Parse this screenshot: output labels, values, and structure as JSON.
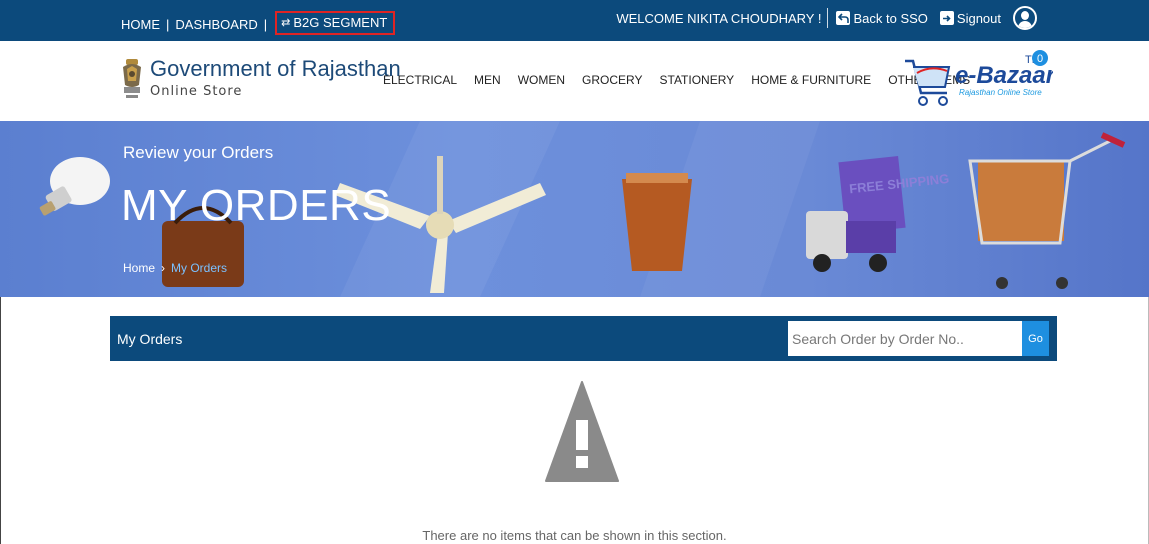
{
  "topbar": {
    "home": "HOME",
    "sep1": "|",
    "dashboard": "DASHBOARD",
    "sep2": "|",
    "b2g_arrows": "⇄",
    "b2g": "B2G SEGMENT",
    "welcome": "WELCOME NIKITA CHOUDHARY !",
    "back_to_sso": "Back to SSO",
    "signout": "Signout"
  },
  "header": {
    "title": "Government of Rajasthan",
    "subtitle": "Online Store",
    "nav": [
      "ELECTRICAL",
      "MEN",
      "WOMEN",
      "GROCERY",
      "STATIONERY",
      "HOME & FURNITURE",
      "OTHER ITEMS"
    ],
    "ebazaar_name": "e-Bazaar",
    "ebazaar_tm": "TM",
    "ebazaar_tagline": "Rajasthan Online Store",
    "cart_count": "0"
  },
  "banner": {
    "subtitle": "Review your Orders",
    "title": "MY ORDERS",
    "breadcrumb_home": "Home",
    "breadcrumb_sep": "›",
    "breadcrumb_current": "My Orders",
    "truck_text": "FREE SHIPPING"
  },
  "orders": {
    "label": "My Orders",
    "search_placeholder": "Search Order by Order No..",
    "go": "Go",
    "empty_message": "There are no items that can be shown in this section."
  },
  "colors": {
    "primary": "#0c4a7c",
    "go_button": "#1e8fe0",
    "highlight": "#e02424",
    "banner": "#6a8ad6"
  }
}
